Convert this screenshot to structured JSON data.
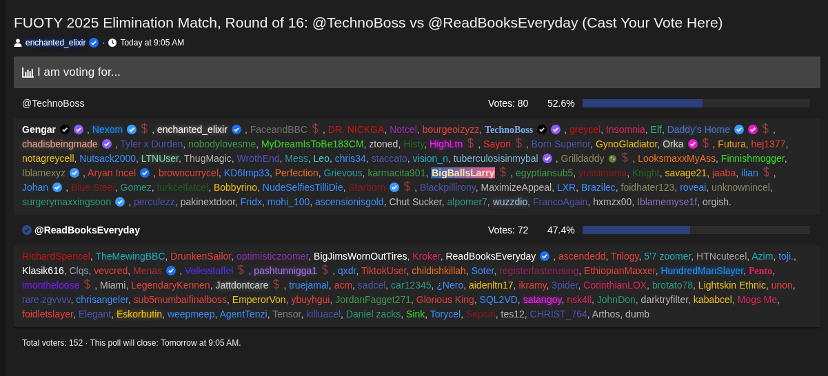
{
  "thread": {
    "title": "FUOTY 2025 Elimination Match, Round of 16: @TechnoBoss vs @ReadBooksEveryday (Cast Your Vote Here)",
    "author": "enchanted_elixir",
    "author_verified": true,
    "separator": "·",
    "time": "Today at 9:05 AM"
  },
  "poll": {
    "heading": "I am voting for...",
    "separator": ",",
    "terminator": ".",
    "options": [
      {
        "name": "@TechnoBoss",
        "selected": false,
        "votes": "Votes: 80",
        "percent": "52.6%",
        "level": 0.526,
        "voters": [
          {
            "name": "Gengar",
            "color": "#ffffff",
            "kind": "bold",
            "badges": [
              {
                "kind": "check",
                "color": "#000000"
              },
              {
                "kind": "check",
                "color": "#8b5cf6"
              }
            ]
          },
          {
            "name": "Nexom",
            "color": "#1e90ff",
            "kind": "glow",
            "badges": [
              {
                "kind": "check",
                "color": "#3b9aff"
              },
              {
                "kind": "dollar"
              }
            ]
          },
          {
            "name": "enchanted_elixir",
            "color": "#ffffff",
            "kind": "glow",
            "badges": [
              {
                "kind": "check",
                "color": "#1d6ff2"
              }
            ]
          },
          {
            "name": "FaceandBBC",
            "color": "#707070",
            "badges": [
              {
                "kind": "dollar"
              }
            ]
          },
          {
            "name": "DR. NICKGA",
            "color": "#cc1111"
          },
          {
            "name": "Notcel",
            "color": "#9b2fa8"
          },
          {
            "name": "bourgeoizyzz",
            "color": "#e8403a"
          },
          {
            "name": "TechnoBoss",
            "color": "#7fa8e8",
            "kind": "serif",
            "badges": [
              {
                "kind": "check",
                "color": "#000000"
              },
              {
                "kind": "check",
                "color": "#8b5cf6"
              }
            ]
          },
          {
            "name": "greycel",
            "color": "#cc1111"
          },
          {
            "name": "Insomnia",
            "color": "#e0245e"
          },
          {
            "name": "Elf",
            "color": "#1fbf8f"
          },
          {
            "name": "Daddy's Home",
            "color": "#4b6fb8",
            "kind": "glow",
            "badges": [
              {
                "kind": "check",
                "color": "#3b9aff"
              },
              {
                "kind": "check",
                "color": "#e020c0"
              },
              {
                "kind": "dollar"
              }
            ]
          },
          {
            "name": "chadisbeingmade",
            "color": "#e0a090",
            "kind": "glow",
            "badges": [
              {
                "kind": "check",
                "color": "#8b5cf6"
              }
            ]
          },
          {
            "name": "Tyler x Durden",
            "color": "#4a55b0"
          },
          {
            "name": "nobodylovesme",
            "color": "#3c9a4a"
          },
          {
            "name": "MyDreamIsToBe183CM",
            "color": "#3bdc2a"
          },
          {
            "name": "ztoned",
            "color": "#c8c8c8"
          },
          {
            "name": "Histy",
            "color": "#1d6b1d"
          },
          {
            "name": "HighLtn",
            "color": "#ff20ff",
            "kind": "glow",
            "badges": [
              {
                "kind": "dollar"
              }
            ]
          },
          {
            "name": "Sayori",
            "color": "#ff2a2a",
            "badges": [
              {
                "kind": "dollar"
              }
            ]
          },
          {
            "name": "Born Superior",
            "color": "#4a55b0"
          },
          {
            "name": "GynoGladiator",
            "color": "#f0c020"
          },
          {
            "name": "Orka",
            "color": "#d0d0d0",
            "kind": "glow",
            "badges": [
              {
                "kind": "check",
                "color": "#e020c0"
              },
              {
                "kind": "dollar"
              }
            ]
          },
          {
            "name": "Futura",
            "color": "#f0a020"
          },
          {
            "name": "hej1377",
            "color": "#e8403a"
          },
          {
            "name": "notagreycell",
            "color": "#f0c020"
          },
          {
            "name": "Nutsack2000",
            "color": "#3b8fff"
          },
          {
            "name": "LTNUser",
            "color": "#80d0b0",
            "kind": "glow"
          },
          {
            "name": "ThugMagic",
            "color": "#b0b0b0"
          },
          {
            "name": "WrothEnd",
            "color": "#5050c0"
          },
          {
            "name": "Mess",
            "color": "#2a9aa0"
          },
          {
            "name": "Leo",
            "color": "#40d0c0"
          },
          {
            "name": "chris34",
            "color": "#3b8fff"
          },
          {
            "name": "staccato",
            "color": "#4a55b0"
          },
          {
            "name": "vision_n",
            "color": "#20b0d0"
          },
          {
            "name": "tuberculosisinmybal",
            "color": "#7fb8d8",
            "badges": [
              {
                "kind": "check",
                "color": "#8b5cf6"
              }
            ]
          },
          {
            "name": "Grilldaddy",
            "color": "#8a8a60",
            "badges": [
              {
                "kind": "emoji"
              },
              {
                "kind": "dollar"
              }
            ]
          },
          {
            "name": "LooksmaxxMyAss",
            "color": "#f07020"
          },
          {
            "name": "Finnishmogger",
            "color": "#3bdc2a"
          },
          {
            "name": "Iblamexyz",
            "color": "#8a8a60",
            "badges": [
              {
                "kind": "check",
                "color": "#3b9aff"
              }
            ]
          },
          {
            "name": "Aryan Incel",
            "color": "#e8403a",
            "badges": [
              {
                "kind": "check",
                "color": "#1d6ff2"
              }
            ]
          },
          {
            "name": "browncurrycel",
            "color": "#e8403a"
          },
          {
            "name": "KD6Imp33",
            "color": "#3b8fff"
          },
          {
            "name": "Perfection",
            "color": "#f07020"
          },
          {
            "name": "Grievous",
            "color": "#2a9aa0"
          },
          {
            "name": "karmacita901",
            "color": "#3c9a4a"
          },
          {
            "name": "BigBallsLarry",
            "kind": "highlight",
            "badges": [
              {
                "kind": "dollar"
              }
            ]
          },
          {
            "name": "egyptiansub5",
            "color": "#3c9a4a"
          },
          {
            "name": "yussimania",
            "color": "#8a1a1a"
          },
          {
            "name": "Knight",
            "color": "#1d6b1d"
          },
          {
            "name": "savage21",
            "color": "#f0c020"
          },
          {
            "name": "jaaba",
            "color": "#e8403a"
          },
          {
            "name": "ilian",
            "color": "#3b8fff",
            "badges": [
              {
                "kind": "dollar"
              }
            ]
          },
          {
            "name": "Johan",
            "color": "#3b8fff",
            "badges": [
              {
                "kind": "check",
                "color": "#3b9aff"
              }
            ]
          },
          {
            "name": "Blue Steel",
            "color": "#8a1a1a"
          },
          {
            "name": "Gomez",
            "color": "#2a9a80"
          },
          {
            "name": "turkcelfatcel",
            "color": "#1d5b1d"
          },
          {
            "name": "Bobbyrino",
            "color": "#f0c020"
          },
          {
            "name": "NudeSelfiesTilliDie",
            "color": "#3b8fff"
          },
          {
            "name": "Starborn",
            "color": "#8a1a1a",
            "badges": [
              {
                "kind": "check",
                "color": "#3b9aff"
              },
              {
                "kind": "dollar"
              }
            ]
          },
          {
            "name": "Blackpillirony",
            "color": "#4a55b0"
          },
          {
            "name": "MaximizeAppeal",
            "color": "#b8b8b8"
          },
          {
            "name": "LXR",
            "color": "#3b8fff"
          },
          {
            "name": "Brazilec",
            "color": "#3b8fff"
          },
          {
            "name": "foidhater123",
            "color": "#8a8a60"
          },
          {
            "name": "roveai",
            "color": "#3b8fff"
          },
          {
            "name": "unknownincel",
            "color": "#8a8a60"
          },
          {
            "name": "surgerymaxxingsoon",
            "color": "#2a9a80",
            "badges": [
              {
                "kind": "check",
                "color": "#3b9aff"
              }
            ]
          },
          {
            "name": "perculezz",
            "color": "#4a55b0"
          },
          {
            "name": "pakinextdoor",
            "color": "#b8b8b8"
          },
          {
            "name": "Fridx",
            "color": "#3b8fff"
          },
          {
            "name": "mohi_100",
            "color": "#3b8fff"
          },
          {
            "name": "ascensionisgold",
            "color": "#3b8fff"
          },
          {
            "name": "Chut Sucker",
            "color": "#b8b8b8"
          },
          {
            "name": "alpomer7",
            "color": "#2a9a80"
          },
          {
            "name": "wuzzdio",
            "color": "#a0b8d0",
            "kind": "glow"
          },
          {
            "name": "FrancoAgain",
            "color": "#4a55b0"
          },
          {
            "name": "hxmzx00",
            "color": "#b8b8b8"
          },
          {
            "name": "Iblamemyse1f",
            "color": "#9070c0"
          },
          {
            "name": "orgish",
            "color": "#b8b8b8"
          }
        ]
      },
      {
        "name": "@ReadBooksEveryday",
        "selected": true,
        "votes": "Votes: 72",
        "percent": "47.4%",
        "level": 0.474,
        "voters": [
          {
            "name": "RichardSpencel",
            "color": "#cc1111"
          },
          {
            "name": "TheMewingBBC",
            "color": "#20b0c0"
          },
          {
            "name": "DrunkenSailor",
            "color": "#e8403a"
          },
          {
            "name": "optimisticzoomer",
            "color": "#8a30b0"
          },
          {
            "name": "BigJimsWornOutTires",
            "color": "#ffffff"
          },
          {
            "name": "Kroker",
            "color": "#e0245e"
          },
          {
            "name": "ReadBooksEveryday",
            "color": "#ffffff",
            "badges": [
              {
                "kind": "check",
                "color": "#1d6ff2"
              }
            ]
          },
          {
            "name": "ascendedd",
            "color": "#e8403a"
          },
          {
            "name": "Trilogy",
            "color": "#e8403a"
          },
          {
            "name": "5'7 zoomer",
            "color": "#20b0c0"
          },
          {
            "name": "HTNcutecel",
            "color": "#a0a0a0"
          },
          {
            "name": "Azim",
            "color": "#20b0c0"
          },
          {
            "name": "toji.",
            "color": "#3b8fff"
          },
          {
            "name": "Klasik616",
            "color": "#ffffff"
          },
          {
            "name": "Clqs",
            "color": "#8aa0c0"
          },
          {
            "name": "vevcred",
            "color": "#e8403a"
          },
          {
            "name": "Menas",
            "color": "#b03030",
            "badges": [
              {
                "kind": "check",
                "color": "#1d6ff2"
              }
            ]
          },
          {
            "name": "Volksstaffel",
            "color": "#5030e0",
            "kind": "strike",
            "badges": [
              {
                "kind": "dollar"
              }
            ]
          },
          {
            "name": "pashtunnigga1",
            "color": "#a070e0",
            "kind": "glow",
            "badges": [
              {
                "kind": "dollar"
              }
            ]
          },
          {
            "name": "qxdr",
            "color": "#3b8fff"
          },
          {
            "name": "TiktokUser",
            "color": "#e8403a"
          },
          {
            "name": "childishkillah",
            "color": "#f07020"
          },
          {
            "name": "Soter",
            "color": "#3b8fff"
          },
          {
            "name": "registerfasterusing",
            "color": "#9a2060"
          },
          {
            "name": "EthiopianMaxxer",
            "color": "#e8403a"
          },
          {
            "name": "HundredManSlayer",
            "color": "#1e90ff",
            "kind": "glow"
          },
          {
            "name": "Pento",
            "color": "#e0245e",
            "kind": "serif"
          },
          {
            "name": "imontheloose",
            "color": "#7020e0",
            "kind": "glow",
            "badges": [
              {
                "kind": "dollar"
              }
            ]
          },
          {
            "name": "Miami",
            "color": "#b8b8b8"
          },
          {
            "name": "LegendaryKennen",
            "color": "#e8403a"
          },
          {
            "name": "Jattdontcare",
            "color": "#d0d0d0",
            "kind": "glow",
            "badges": [
              {
                "kind": "dollar"
              }
            ]
          },
          {
            "name": "truejamal",
            "color": "#3b8fff"
          },
          {
            "name": "acm",
            "color": "#e8403a"
          },
          {
            "name": "sadcel",
            "color": "#4a55b0"
          },
          {
            "name": "car12345",
            "color": "#2a9a80"
          },
          {
            "name": "¿Nero",
            "color": "#3b8fff"
          },
          {
            "name": "aidenltn17",
            "color": "#f0c020"
          },
          {
            "name": "ikramy",
            "color": "#e8403a"
          },
          {
            "name": "3pider",
            "color": "#4a55b0"
          },
          {
            "name": "CorinthianLOX",
            "color": "#e0245e"
          },
          {
            "name": "brotato78",
            "color": "#2a9a80"
          },
          {
            "name": "Lightskin Ethnic",
            "color": "#f0c020"
          },
          {
            "name": "unon",
            "color": "#e8403a"
          },
          {
            "name": "rare.zgvvvv",
            "color": "#4a55b0"
          },
          {
            "name": "chrisangeler",
            "color": "#3b8fff"
          },
          {
            "name": "sub5mumbaifinalboss",
            "color": "#e8403a"
          },
          {
            "name": "EmperorVon",
            "color": "#f0c020"
          },
          {
            "name": "ybuyhgui",
            "color": "#e8403a"
          },
          {
            "name": "JordanFagget271",
            "color": "#3c9a4a"
          },
          {
            "name": "Glorious King",
            "color": "#e8403a"
          },
          {
            "name": "SQL2VD",
            "color": "#3b8fff"
          },
          {
            "name": "satangoy",
            "color": "#ff20ff",
            "kind": "glow"
          },
          {
            "name": "nsk4ll",
            "color": "#e0245e"
          },
          {
            "name": "JohnDon",
            "color": "#2a9a80"
          },
          {
            "name": "darktryfilter",
            "color": "#b8b8b8"
          },
          {
            "name": "kababcel",
            "color": "#f0c020"
          },
          {
            "name": "Mogs Me",
            "color": "#e0245e"
          },
          {
            "name": "foidletslayer",
            "color": "#e8403a"
          },
          {
            "name": "Elegant",
            "color": "#4a55b0"
          },
          {
            "name": "Eskorbutin",
            "color": "#f0c020",
            "kind": "glow"
          },
          {
            "name": "weepmeep",
            "color": "#3b8fff"
          },
          {
            "name": "AgentTenzi",
            "color": "#3b8fff"
          },
          {
            "name": "Tensor",
            "color": "#808080"
          },
          {
            "name": "killuacel",
            "color": "#4a55b0"
          },
          {
            "name": "Daniel zacks",
            "color": "#2a9a80"
          },
          {
            "name": "Sink",
            "color": "#3bdc2a"
          },
          {
            "name": "Torycel",
            "color": "#3b8fff"
          },
          {
            "name": "Sepsin",
            "color": "#8a1a1a"
          },
          {
            "name": "tes12",
            "color": "#b8b8b8"
          },
          {
            "name": "CHRIST_764",
            "color": "#4a55b0"
          },
          {
            "name": "Arthos",
            "color": "#b8b8b8"
          },
          {
            "name": "dumb",
            "color": "#b8b8b8"
          }
        ]
      }
    ],
    "footer": "Total voters: 152 · This poll will close: Tomorrow at 9:05 AM."
  }
}
